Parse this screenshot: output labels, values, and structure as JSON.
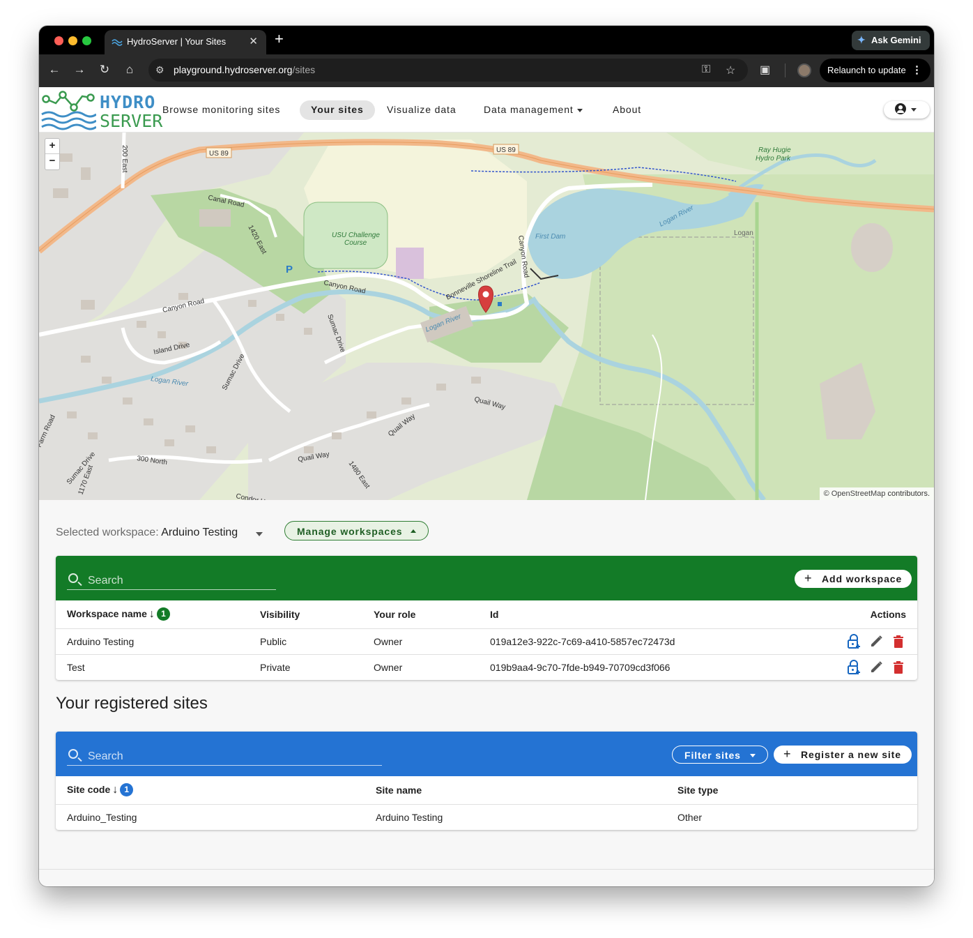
{
  "browser": {
    "tab_title": "HydroServer | Your Sites",
    "tab_close": "✕",
    "new_tab": "+",
    "gemini_label": "Ask Gemini",
    "url_host": "playground.hydroserver.org",
    "url_path": "/sites",
    "relaunch_label": "Relaunch to update",
    "traffic_colors": [
      "#ff5f57",
      "#febc2e",
      "#28c840"
    ]
  },
  "app": {
    "logo_line1": "HYDRO",
    "logo_line2": "SERVER",
    "nav": [
      {
        "label": "Browse monitoring sites",
        "active": false
      },
      {
        "label": "Your sites",
        "active": true
      },
      {
        "label": "Visualize data",
        "active": false
      },
      {
        "label": "Data management",
        "active": false,
        "dropdown": true
      },
      {
        "label": "About",
        "active": false
      }
    ],
    "account_icon": "account-circle-icon"
  },
  "map": {
    "zoom_in": "+",
    "zoom_out": "−",
    "attribution_prefix": "©",
    "attribution_link": "OpenStreetMap",
    "attribution_suffix": "contributors.",
    "labels": {
      "us89_a": "US 89",
      "us89_b": "US 89",
      "canal_road": "Canal Road",
      "road_1420": "1420 East",
      "road_200": "200 East",
      "usu": "USU Challenge",
      "usu2": "Course",
      "canyon_road_1": "Canyon Road",
      "canyon_road_2": "Canyon Road",
      "canyon_road_3": "Canyon Road",
      "island_drive": "Island Drive",
      "logan_river_1": "Logan River",
      "logan_river_2": "Logan River",
      "logan_river_3": "Logan River",
      "sumac_1": "Sumac Drive",
      "sumac_2": "Sumac Drive",
      "sumac_3": "Sumac Drive",
      "first_dam": "First Dam",
      "bonneville": "Bonneville Shoreline Trail",
      "ray_hugie_1": "Ray Hugie",
      "ray_hugie_2": "Hydro Park",
      "logan": "Logan",
      "quail_1": "Quail Way",
      "quail_2": "Quail Way",
      "quail_3": "Quail Way",
      "road_300n": "300 North",
      "road_1480": "1480 East",
      "road_1170": "1170 East",
      "farm_road": "Farm Road",
      "condor": "Condor Heights",
      "parking": "P"
    },
    "marker_color": "#d63e3e"
  },
  "workspace": {
    "selected_label": "Selected workspace:",
    "selected_value": "Arduino Testing",
    "manage_label": "Manage workspaces",
    "header_color": "#137b27",
    "search_placeholder": "Search",
    "add_label": "Add workspace",
    "columns": [
      "Workspace name",
      "Visibility",
      "Your role",
      "Id",
      "Actions"
    ],
    "sort_badge": "1",
    "rows": [
      {
        "name": "Arduino Testing",
        "visibility": "Public",
        "role": "Owner",
        "id": "019a12e3-922c-7c69-a410-5857ec72473d"
      },
      {
        "name": "Test",
        "visibility": "Private",
        "role": "Owner",
        "id": "019b9aa4-9c70-7fde-b949-70709cd3f066"
      }
    ],
    "action_icons": [
      "lock-plus-icon",
      "pencil-icon",
      "trash-icon"
    ]
  },
  "sites": {
    "title": "Your registered sites",
    "header_color": "#2473d3",
    "search_placeholder": "Search",
    "filter_label": "Filter sites",
    "register_label": "Register a new site",
    "columns": [
      "Site code",
      "Site name",
      "Site type"
    ],
    "sort_badge": "1",
    "rows": [
      {
        "code": "Arduino_Testing",
        "name": "Arduino Testing",
        "type": "Other"
      }
    ]
  }
}
